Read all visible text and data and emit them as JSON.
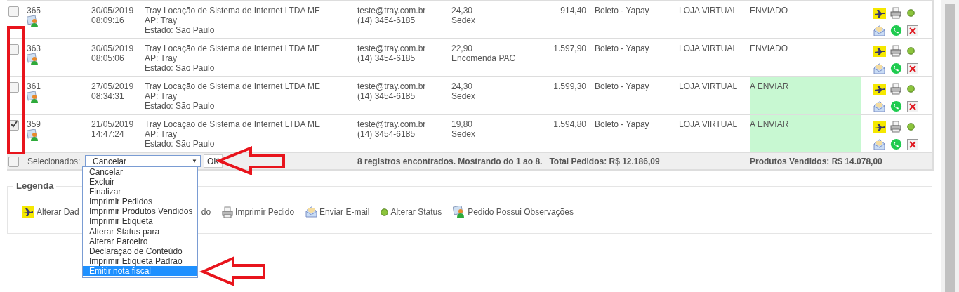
{
  "orders": [
    {
      "checked": false,
      "id": "365",
      "date": "30/05/2019",
      "time": "08:09:16",
      "customer": "Tray Locação de Sistema de Internet LTDA ME",
      "contact": "AP: Tray",
      "state": "Estado: São Paulo",
      "email": "teste@tray.com.br",
      "phone": "(14) 3454-6185",
      "freight": "24,30",
      "shipping": "Sedex",
      "total": "914,40",
      "payment": "Boleto - Yapay",
      "origin": "LOJA VIRTUAL",
      "status": "ENVIADO",
      "status_highlighted": false
    },
    {
      "checked": false,
      "id": "363",
      "date": "30/05/2019",
      "time": "08:05:06",
      "customer": "Tray Locação de Sistema de Internet LTDA ME",
      "contact": "AP: Tray",
      "state": "Estado: São Paulo",
      "email": "teste@tray.com.br",
      "phone": "(14) 3454-6185",
      "freight": "22,90",
      "shipping": "Encomenda PAC",
      "total": "1.597,90",
      "payment": "Boleto - Yapay",
      "origin": "LOJA VIRTUAL",
      "status": "ENVIADO",
      "status_highlighted": false
    },
    {
      "checked": false,
      "id": "361",
      "date": "27/05/2019",
      "time": "08:34:31",
      "customer": "Tray Locação de Sistema de Internet LTDA ME",
      "contact": "AP: Tray",
      "state": "Estado: São Paulo",
      "email": "teste@tray.com.br",
      "phone": "(14) 3454-6185",
      "freight": "24,30",
      "shipping": "Sedex",
      "total": "1.599,30",
      "payment": "Boleto - Yapay",
      "origin": "LOJA VIRTUAL",
      "status": "A ENVIAR",
      "status_highlighted": true
    },
    {
      "checked": true,
      "id": "359",
      "date": "21/05/2019",
      "time": "14:47:24",
      "customer": "Tray Locação de Sistema de Internet LTDA ME",
      "contact": "AP: Tray",
      "state": "Estado: São Paulo",
      "email": "teste@tray.com.br",
      "phone": "(14) 3454-6185",
      "freight": "19,80",
      "shipping": "Sedex",
      "total": "1.594,80",
      "payment": "Boleto - Yapay",
      "origin": "LOJA VIRTUAL",
      "status": "A ENVIAR",
      "status_highlighted": true
    }
  ],
  "footer": {
    "checked": false,
    "label": "Selecionados:",
    "select_value": "Cancelar",
    "select_caret": "▼",
    "button": "OK",
    "records": "8 registros encontrados. Mostrando do 1 ao 8.",
    "total_orders": "Total Pedidos: R$ 12.186,09",
    "products_sold": "Produtos Vendidos: R$ 14.078,00"
  },
  "dropdown_options": [
    {
      "label": "Cancelar",
      "selected": false
    },
    {
      "label": "Excluir",
      "selected": false
    },
    {
      "label": "Finalizar",
      "selected": false
    },
    {
      "label": "Imprimir Pedidos",
      "selected": false
    },
    {
      "label": "Imprimir Produtos Vendidos",
      "selected": false
    },
    {
      "label": "Imprimir Etiqueta",
      "selected": false
    },
    {
      "label": "Alterar Status para",
      "selected": false
    },
    {
      "label": "Alterar Parceiro",
      "selected": false
    },
    {
      "label": "Declaração de Conteúdo",
      "selected": false
    },
    {
      "label": "Imprimir Etiqueta Padrão",
      "selected": false
    },
    {
      "label": "Emitir nota fiscal",
      "selected": true
    }
  ],
  "legend": {
    "title": "Legenda",
    "items": [
      {
        "kind": "plane",
        "label": "Alterar Dad",
        "label_tail": "do"
      },
      {
        "kind": "printer",
        "label": "Imprimir Pedido"
      },
      {
        "kind": "envelope",
        "label": "Enviar E-mail"
      },
      {
        "kind": "dot",
        "label": "Alterar Status"
      },
      {
        "kind": "note",
        "label": "Pedido Possui Observações"
      }
    ]
  }
}
